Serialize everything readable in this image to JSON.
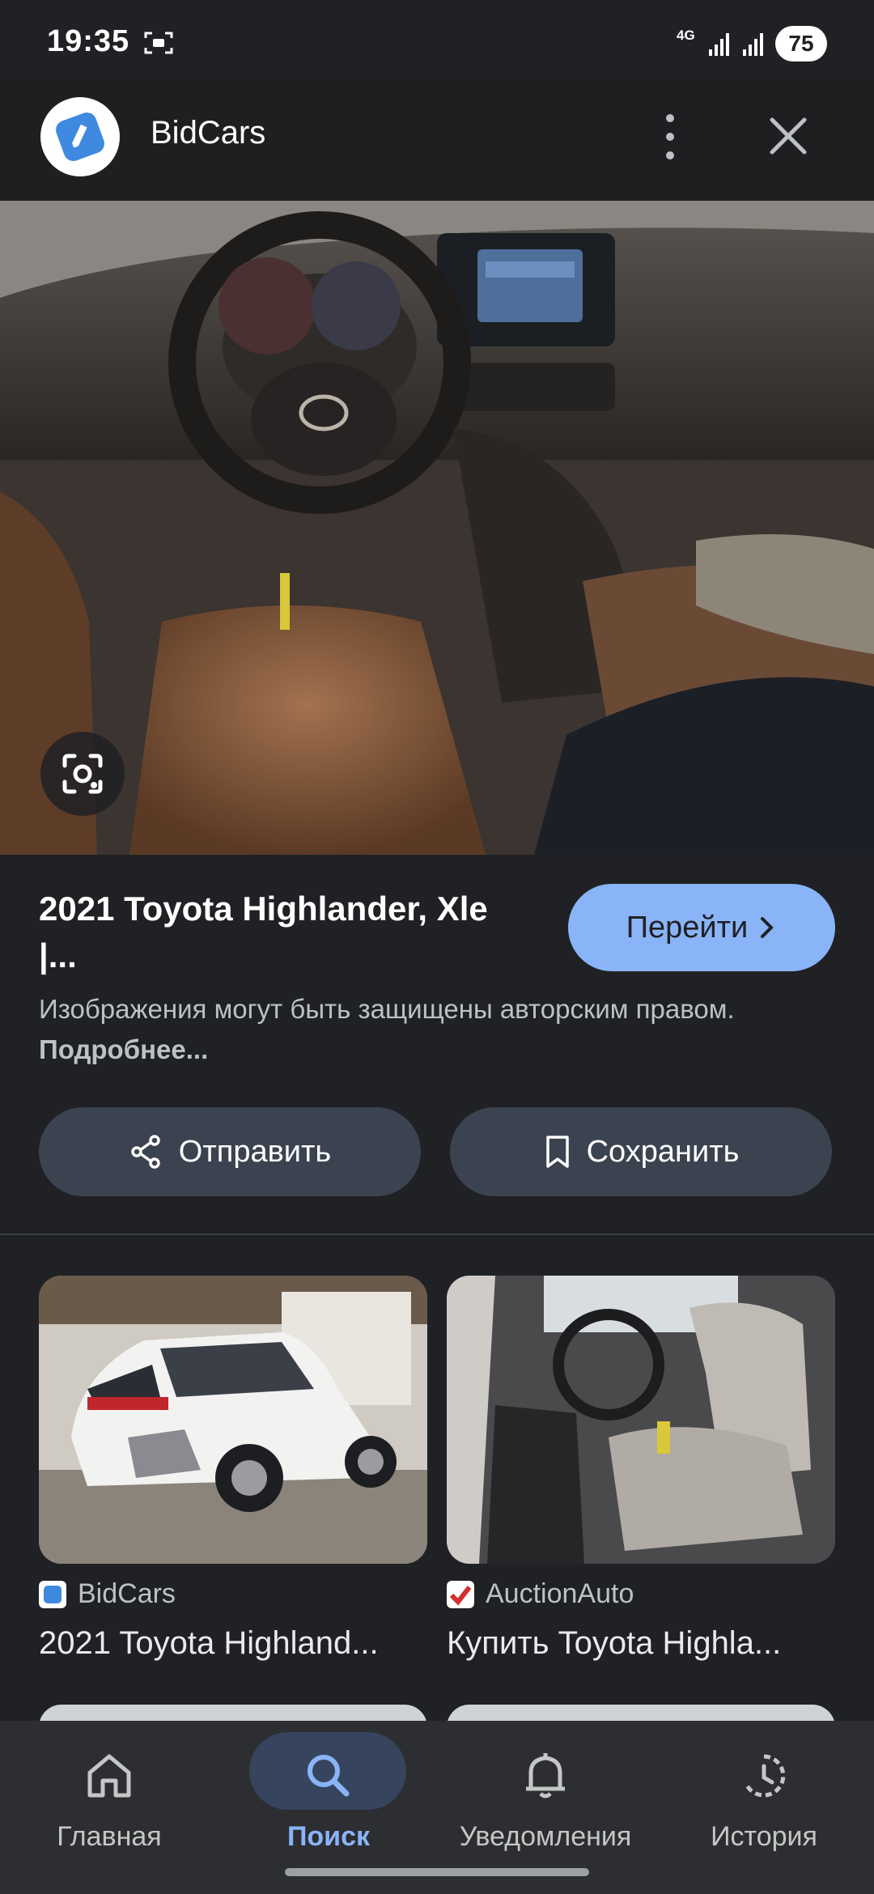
{
  "status_bar": {
    "time": "19:35",
    "network": "4G",
    "battery": "75"
  },
  "header": {
    "site_name": "BidCars",
    "icons": {
      "more": "more-vert-icon",
      "close": "close-icon",
      "logo": "bidcars-logo-icon"
    }
  },
  "result": {
    "title": "2021 Toyota Highlander, Xle |...",
    "visit_label": "Перейти",
    "copyright_text": "Изображения могут быть защищены авторским правом.",
    "more_link": "Подробнее..."
  },
  "actions": {
    "share_label": "Отправить",
    "save_label": "Сохранить"
  },
  "related": [
    {
      "source": "BidCars",
      "title": "2021 Toyota Highland...",
      "favicon": "bidcars-favicon"
    },
    {
      "source": "AuctionAuto",
      "title": "Купить Toyota Highla...",
      "favicon": "auctionauto-favicon"
    }
  ],
  "bottom_nav": {
    "items": [
      {
        "label": "Главная",
        "icon": "home-icon"
      },
      {
        "label": "Поиск",
        "icon": "search-icon",
        "active": true
      },
      {
        "label": "Уведомления",
        "icon": "bell-icon"
      },
      {
        "label": "История",
        "icon": "history-icon"
      }
    ]
  },
  "colors": {
    "background": "#202124",
    "accent": "#8ab4f8",
    "button_bg": "#3c4350",
    "nav_active_pill": "#36445d"
  }
}
